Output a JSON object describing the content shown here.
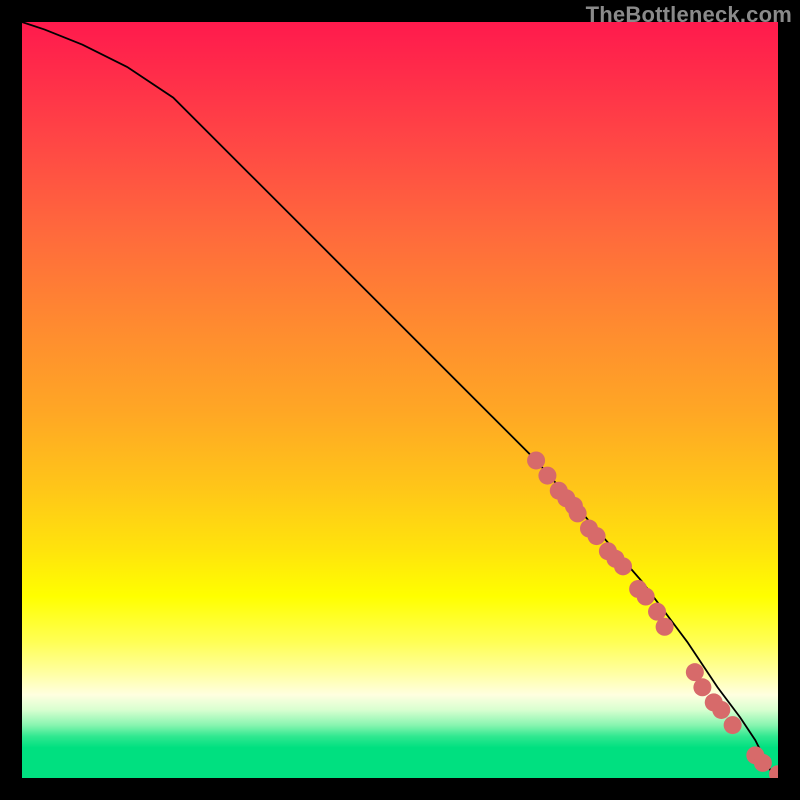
{
  "watermark": "TheBottleneck.com",
  "chart_data": {
    "type": "line",
    "title": "",
    "xlabel": "",
    "ylabel": "",
    "xlim": [
      0,
      100
    ],
    "ylim": [
      0,
      100
    ],
    "grid": false,
    "legend": false,
    "series": [
      {
        "name": "curve",
        "kind": "line",
        "x": [
          0,
          3,
          8,
          14,
          20,
          30,
          40,
          50,
          60,
          68,
          75,
          82,
          88,
          92,
          95,
          97,
          99,
          100
        ],
        "y": [
          100,
          99,
          97,
          94,
          90,
          80,
          70,
          60,
          50,
          42,
          34,
          26,
          18,
          12,
          8,
          5,
          1,
          0.5
        ]
      },
      {
        "name": "points",
        "kind": "scatter",
        "x": [
          68,
          69.5,
          71,
          72,
          73,
          73.5,
          75,
          76,
          77.5,
          78.5,
          79.5,
          81.5,
          82.5,
          84,
          85,
          89,
          90,
          91.5,
          92.5,
          94,
          97,
          98,
          100
        ],
        "y": [
          42,
          40,
          38,
          37,
          36,
          35,
          33,
          32,
          30,
          29,
          28,
          25,
          24,
          22,
          20,
          14,
          12,
          10,
          9,
          7,
          3,
          2,
          0.5
        ]
      }
    ],
    "point_color": "#d76a6a",
    "line_color": "#000000"
  }
}
